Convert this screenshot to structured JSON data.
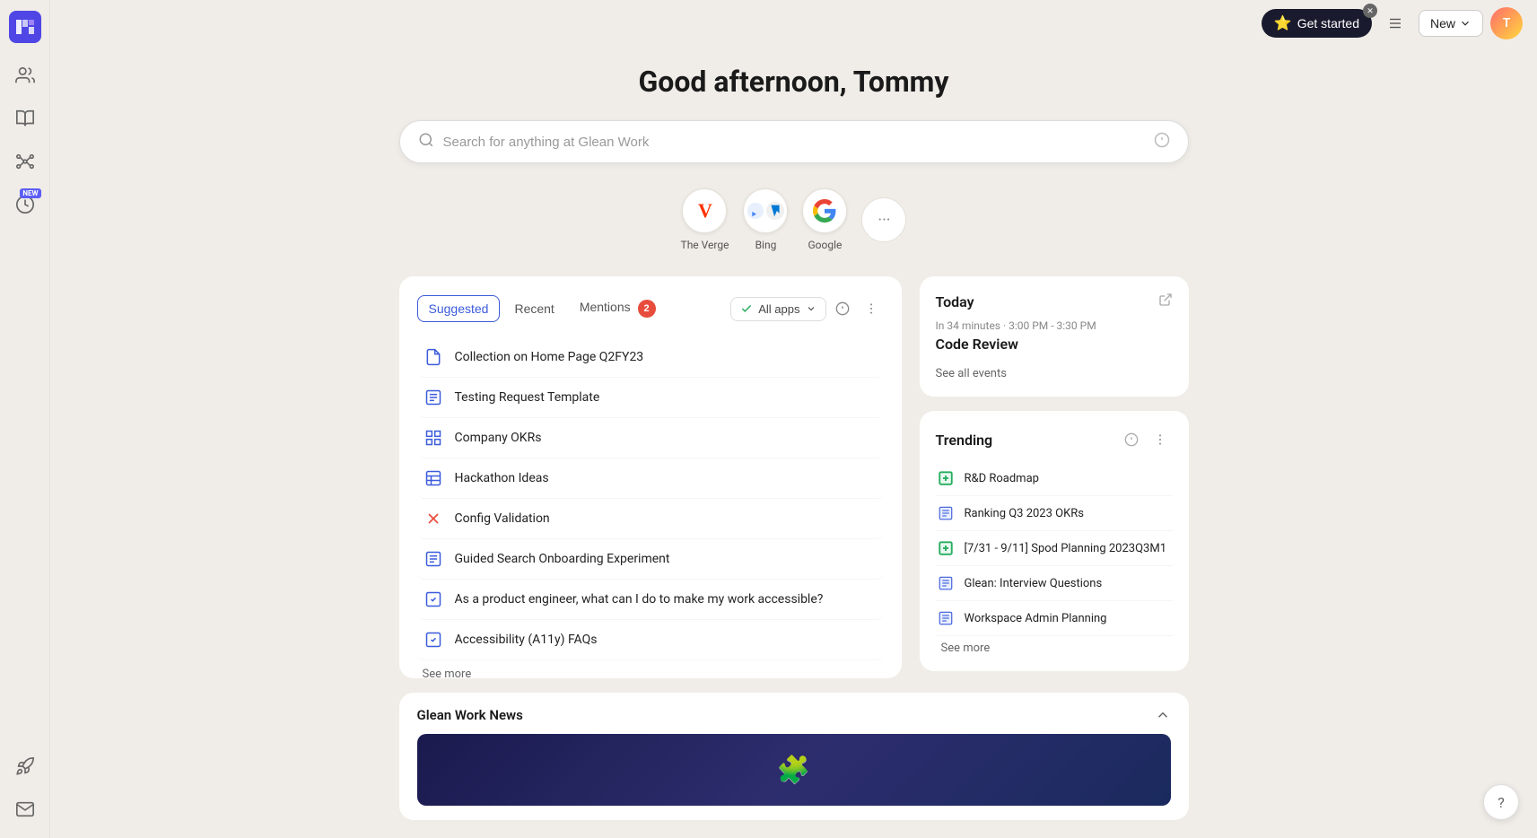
{
  "app": {
    "title": "Glean Work"
  },
  "topbar": {
    "get_started_label": "Get started",
    "new_label": "New",
    "settings_icon": "settings-icon"
  },
  "greeting": "Good afternoon, Tommy",
  "search": {
    "placeholder": "Search for anything at Glean Work"
  },
  "sources": [
    {
      "id": "verge",
      "label": "The Verge",
      "type": "verge"
    },
    {
      "id": "bing",
      "label": "Bing",
      "type": "bing"
    },
    {
      "id": "google",
      "label": "Google",
      "type": "google"
    },
    {
      "id": "more",
      "label": "",
      "type": "more"
    }
  ],
  "suggestions": {
    "tabs": [
      {
        "id": "suggested",
        "label": "Suggested",
        "active": true,
        "badge": null
      },
      {
        "id": "recent",
        "label": "Recent",
        "active": false,
        "badge": null
      },
      {
        "id": "mentions",
        "label": "Mentions",
        "active": false,
        "badge": 2
      }
    ],
    "filter_label": "All apps",
    "items": [
      {
        "icon": "doc-icon",
        "icon_type": "blue-doc",
        "text": "Collection on Home Page Q2FY23"
      },
      {
        "icon": "doc-lines-icon",
        "icon_type": "blue-lines",
        "text": "Testing Request Template"
      },
      {
        "icon": "grid-icon",
        "icon_type": "blue-grid",
        "text": "Company OKRs"
      },
      {
        "icon": "board-icon",
        "icon_type": "blue-board",
        "text": "Hackathon Ideas"
      },
      {
        "icon": "cross-icon",
        "icon_type": "cross",
        "text": "Config Validation"
      },
      {
        "icon": "doc-lines-icon",
        "icon_type": "blue-lines",
        "text": "Guided Search Onboarding Experiment"
      },
      {
        "icon": "check-icon",
        "icon_type": "check",
        "text": "As a product engineer, what can I do to make my work accessible?"
      },
      {
        "icon": "check-icon",
        "icon_type": "check",
        "text": "Accessibility (A11y) FAQs"
      }
    ],
    "see_more_label": "See more"
  },
  "calendar": {
    "title": "Today",
    "subtitle": "In 34 minutes · 3:00 PM - 3:30 PM",
    "event": "Code Review",
    "see_all_label": "See all events"
  },
  "trending": {
    "title": "Trending",
    "items": [
      {
        "icon": "green-plus-icon",
        "icon_type": "green-plus",
        "text": "R&D Roadmap"
      },
      {
        "icon": "blue-lines-icon",
        "icon_type": "blue-lines",
        "text": "Ranking Q3 2023 OKRs"
      },
      {
        "icon": "green-plus-icon",
        "icon_type": "green-plus",
        "text": "[7/31 - 9/11] Spod Planning 2023Q3M1"
      },
      {
        "icon": "blue-lines-icon",
        "icon_type": "blue-lines",
        "text": "Glean: Interview Questions"
      },
      {
        "icon": "blue-lines-icon",
        "icon_type": "blue-lines",
        "text": "Workspace Admin Planning"
      }
    ],
    "see_more_label": "See more"
  },
  "news": {
    "title": "Glean Work News",
    "expanded": true
  }
}
